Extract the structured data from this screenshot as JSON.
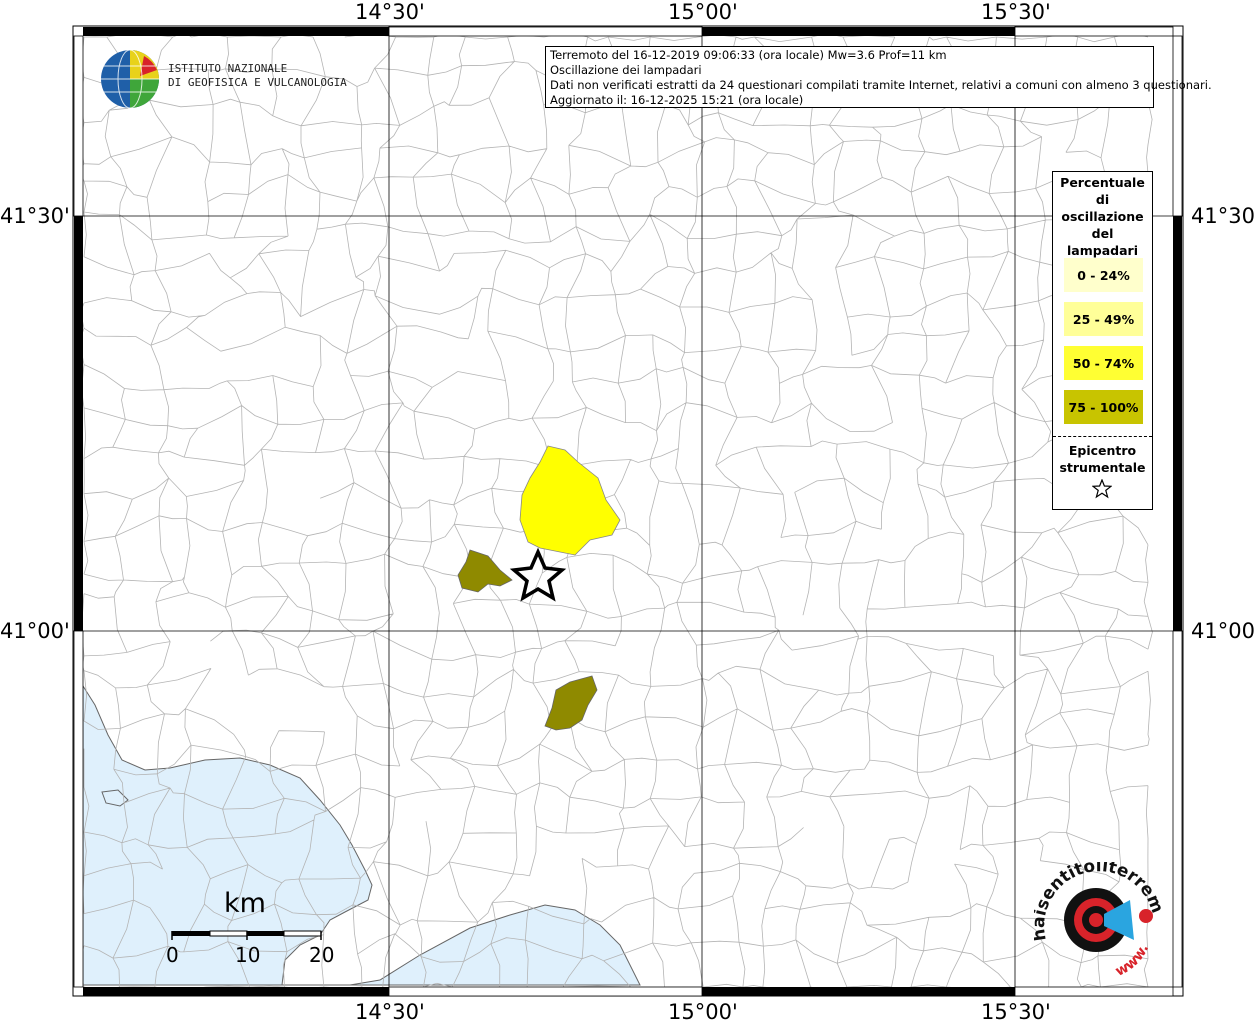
{
  "header": {
    "line1": "Terremoto del 16-12-2019 09:06:33 (ora locale) Mw=3.6 Prof=11 km",
    "line2": "Oscillazione dei lampadari",
    "line3": "Dati non verificati estratti da 24 questionari compilati tramite Internet, relativi a comuni con almeno 3 questionari.",
    "line4": "Aggiornato il: 16-12-2025 15:21 (ora locale)"
  },
  "logo": {
    "line1": "ISTITUTO NAZIONALE",
    "line2": "DI GEOFISICA E VULCANOLOGIA"
  },
  "axes": {
    "longitude_ticks": [
      "14°30'",
      "15°00'",
      "15°30'"
    ],
    "latitude_ticks": [
      "41°30'",
      "41°00'"
    ]
  },
  "legend": {
    "title_lines": [
      "Percentuale",
      "di",
      "oscillazione",
      "del",
      "lampadari"
    ],
    "classes": [
      {
        "label": "0 - 24%",
        "color": "#ffffcc"
      },
      {
        "label": "25 - 49%",
        "color": "#ffff99"
      },
      {
        "label": "50 - 74%",
        "color": "#ffff33"
      },
      {
        "label": "75 - 100%",
        "color": "#c8c400"
      }
    ],
    "epicenter_lines": [
      "Epicentro",
      "strumentale"
    ],
    "epicenter_icon": "star-outline-icon"
  },
  "scale_bar": {
    "unit": "km",
    "labels": [
      "0",
      "10",
      "20"
    ]
  },
  "areas": [
    {
      "name": "yellow-municipality",
      "class": "50 - 74%",
      "color": "#ffff00"
    },
    {
      "name": "olive-municipality-west",
      "class": "75 - 100%",
      "color": "#8f8a00"
    },
    {
      "name": "olive-municipality-south",
      "class": "75 - 100%",
      "color": "#8f8a00"
    }
  ],
  "colors": {
    "sea": "#dff0fc",
    "boundary": "#b4b4b4",
    "grid": "#000000"
  },
  "brand": {
    "text_top": "haisentitoilterremoto.it",
    "text_bottom": "www."
  }
}
